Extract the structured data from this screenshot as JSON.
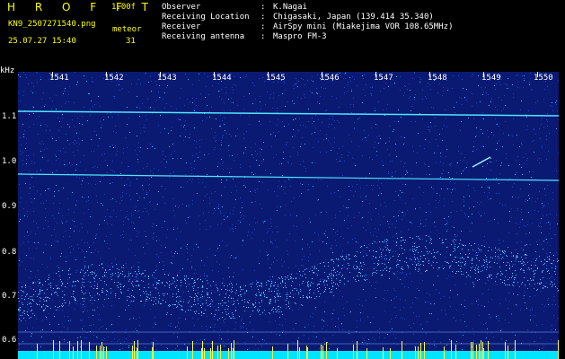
{
  "header": {
    "app_name": "H R O F F T",
    "version": "1.00f",
    "filename": "KN9_2507271540.png",
    "datetime": "25.07.27 15:40",
    "meteor_label": "meteor",
    "meteor_count": "31"
  },
  "metadata": [
    {
      "key": "Observer",
      "value": "K.Nagai"
    },
    {
      "key": "Receiving Location",
      "value": "Chigasaki, Japan (139.414 35.340)"
    },
    {
      "key": "Receiver",
      "value": "AirSpy mini (Miakejima VOR 108.65MHz)"
    },
    {
      "key": "Receiving antenna",
      "value": "Maspro FM-3"
    }
  ],
  "axis": {
    "y_unit": "kHz",
    "y_ticks": [
      "1.1",
      "1.0",
      "0.9",
      "0.8",
      "0.7",
      "0.6"
    ],
    "x_ticks": [
      "1541",
      "1542",
      "1543",
      "1544",
      "1545",
      "1546",
      "1547",
      "1548",
      "1549",
      "1550"
    ]
  },
  "colors": {
    "background": "#0a1a73",
    "noise_dim": "#1f47c4",
    "noise_bright": "#3fb6ff",
    "carrier": "#4fe6ff",
    "header_yellow": "#ffff00",
    "baseline": "#00e5ff"
  }
}
